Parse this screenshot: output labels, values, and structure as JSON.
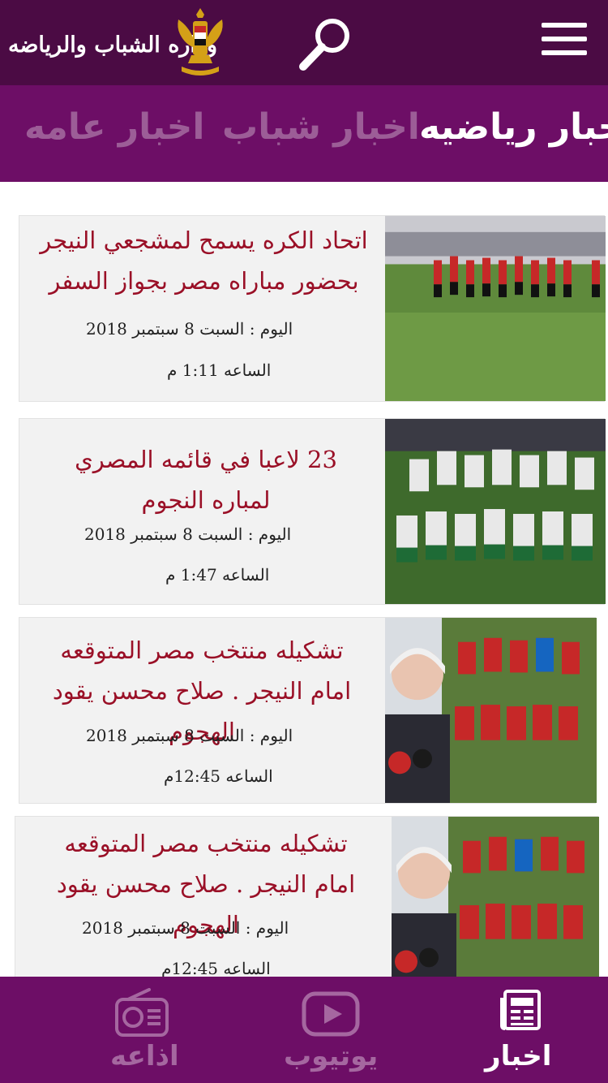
{
  "header": {
    "title": "وزاره الشباب والرياضه",
    "logo_icon": "egypt-eagle-emblem",
    "search_icon": "search-icon",
    "menu_icon": "menu-icon"
  },
  "tabs": [
    {
      "label": "اخبار رياضيه",
      "active": true
    },
    {
      "label": "اخبار شباب",
      "active": false
    },
    {
      "label": "اخبار عامه",
      "active": false
    }
  ],
  "news": [
    {
      "headline": "اتحاد الكره يسمح لمشجعي النيجر بحضور مباراه مصر بجواز السفر",
      "date": "اليوم : السبت 8 سبتمبر 2018",
      "time": "الساعه 1:11 م"
    },
    {
      "headline": "23 لاعبا في قائمه المصري لمباره النجوم",
      "date": "اليوم : السبت 8 سبتمبر 2018",
      "time": "الساعه 1:47 م"
    },
    {
      "headline": "تشكيله منتخب مصر المتوقعه امام النيجر . صلاح محسن يقود الهجوم",
      "date": "اليوم : السبت 8 سبتمبر 2018",
      "time": "الساعه 12:45م"
    },
    {
      "headline": "تشكيله منتخب مصر المتوقعه امام النيجر . صلاح محسن يقود الهجوم",
      "date": "اليوم : السبت 8 سبتمبر 2018",
      "time": "الساعه 12:45م"
    }
  ],
  "bottom_nav": [
    {
      "label": "اخبار",
      "icon": "newspaper-icon",
      "active": true
    },
    {
      "label": "يوتيوب",
      "icon": "youtube-icon",
      "active": false
    },
    {
      "label": "اذاعه",
      "icon": "radio-icon",
      "active": false
    }
  ],
  "colors": {
    "header_bg": "#4b0b44",
    "tabs_bg": "#6d0e66",
    "headline": "#9a1027",
    "inactive": "#9c5d97"
  }
}
